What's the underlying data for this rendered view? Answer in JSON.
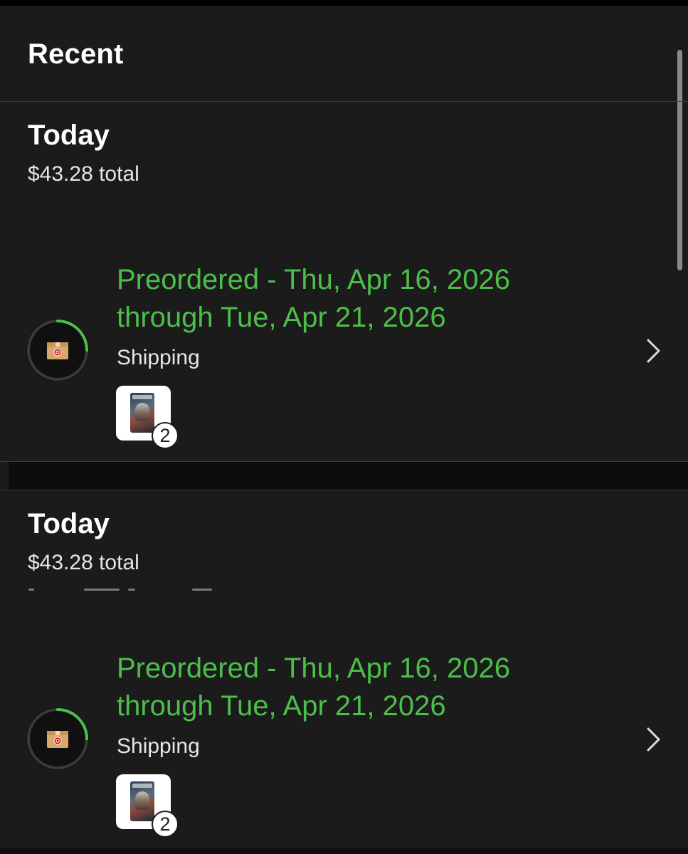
{
  "section": {
    "title": "Recent"
  },
  "groups": [
    {
      "date": "Today",
      "total": "$43.28 total",
      "order": {
        "status_line1": "Preordered - Thu, Apr 16, 2026",
        "status_line2": "through Tue, Apr 21, 2026",
        "substatus": "Shipping",
        "item_count": "2",
        "progress": 0.25,
        "icon": "box-icon",
        "chevron_icon": "chevron-right-icon"
      }
    },
    {
      "date": "Today",
      "total": "$43.28 total",
      "order": {
        "status_line1": "Preordered - Thu, Apr 16, 2026",
        "status_line2": "through Tue, Apr 21, 2026",
        "substatus": "Shipping",
        "item_count": "2",
        "progress": 0.25,
        "icon": "box-icon",
        "chevron_icon": "chevron-right-icon"
      }
    }
  ],
  "colors": {
    "background": "#1b1b1b",
    "status_green": "#4cbf4a",
    "ring_track": "#3a3a3a",
    "ring_progress": "#4cbf4a",
    "target_red": "#cc0000"
  }
}
